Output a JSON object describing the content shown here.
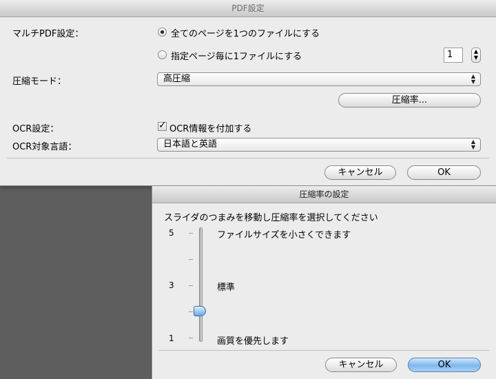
{
  "main_dialog": {
    "title": "PDF設定",
    "multi_pdf_label": "マルチPDF設定：",
    "radio_all_pages": "全てのページを1つのファイルにする",
    "radio_per_pages": "指定ページ毎に1ファイルにする",
    "pages_per_file_value": "1",
    "compression_mode_label": "圧縮モード：",
    "compression_mode_value": "高圧縮",
    "compression_rate_button": "圧縮率...",
    "ocr_label": "OCR設定：",
    "ocr_checkbox_label": "OCR情報を付加する",
    "ocr_checkbox_checked": true,
    "ocr_language_label": "OCR対象言語：",
    "ocr_language_value": "日本語と英語",
    "cancel_button": "キャンセル",
    "ok_button": "OK"
  },
  "compression_sheet": {
    "title": "圧縮率の設定",
    "instruction": "スライダのつまみを移動し圧縮率を選択してください",
    "scale": {
      "top_number": "5",
      "middle_number": "3",
      "bottom_number": "1",
      "top_label": "ファイルサイズを小さくできます",
      "middle_label": "標準",
      "bottom_label": "画質を優先します"
    },
    "slider_value": 2,
    "slider_min": 1,
    "slider_max": 5,
    "cancel_button": "キャンセル",
    "ok_button": "OK"
  },
  "colors": {
    "default_button_blue": "#7fb8ec",
    "desktop_gray": "#5e5e5e"
  }
}
